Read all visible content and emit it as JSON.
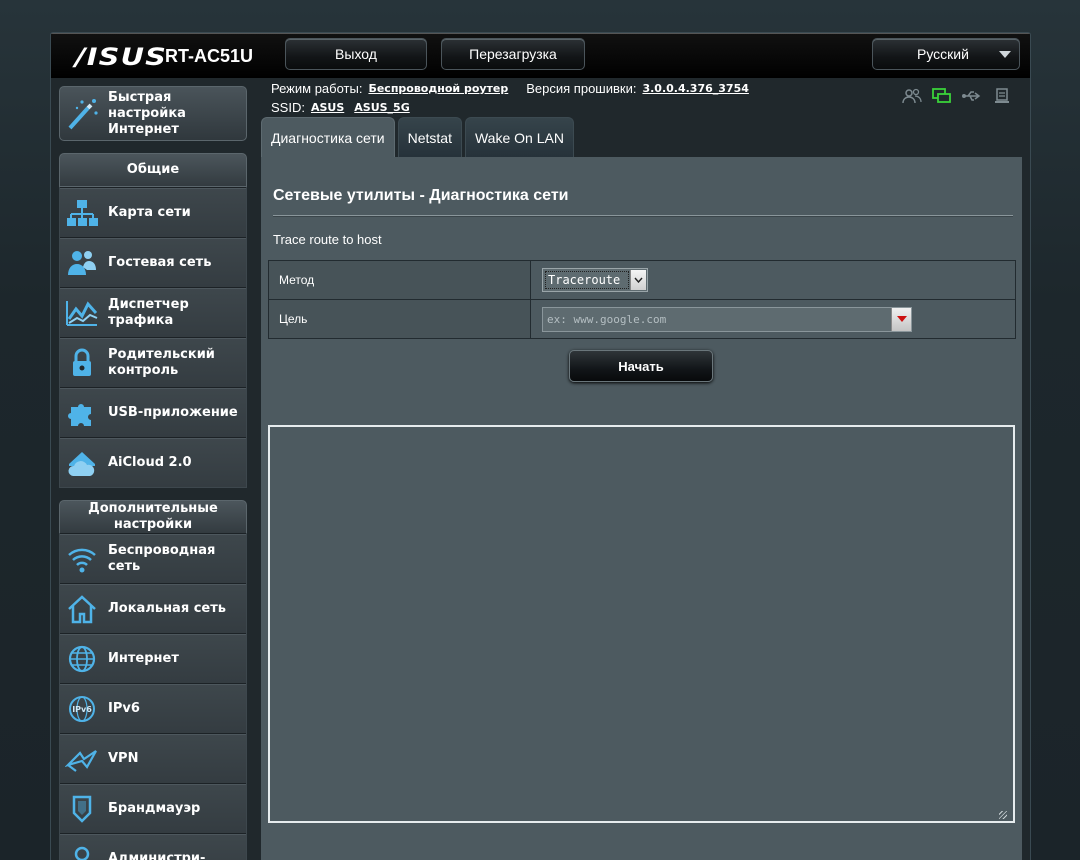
{
  "header": {
    "brand": "/ISUS",
    "model": "RT-AC51U",
    "logout_label": "Выход",
    "reboot_label": "Перезагрузка",
    "language_label": "Русский"
  },
  "status": {
    "mode_label": "Режим работы:",
    "mode_value": "Беспроводной роутер",
    "firmware_label": "Версия прошивки:",
    "firmware_value": "3.0.0.4.376_3754",
    "ssid_label": "SSID:",
    "ssid_1": "ASUS",
    "ssid_2": "ASUS_5G"
  },
  "sidebar": {
    "quick_setup": "Быстрая настройка Интернет",
    "general_header": "Общие",
    "general_items": [
      {
        "label": "Карта сети",
        "icon": "network-map-icon"
      },
      {
        "label": "Гостевая сеть",
        "icon": "guest-network-icon"
      },
      {
        "label": "Диспетчер трафика",
        "icon": "traffic-manager-icon"
      },
      {
        "label": "Родительский контроль",
        "icon": "parental-control-icon"
      },
      {
        "label": "USB-приложение",
        "icon": "usb-app-icon"
      },
      {
        "label": "AiCloud 2.0",
        "icon": "aicloud-icon"
      }
    ],
    "advanced_header": "Дополнительные настройки",
    "advanced_items": [
      {
        "label": "Беспроводная сеть",
        "icon": "wireless-icon"
      },
      {
        "label": "Локальная сеть",
        "icon": "lan-icon"
      },
      {
        "label": "Интернет",
        "icon": "wan-icon"
      },
      {
        "label": "IPv6",
        "icon": "ipv6-icon"
      },
      {
        "label": "VPN",
        "icon": "vpn-icon"
      },
      {
        "label": "Брандмауэр",
        "icon": "firewall-icon"
      },
      {
        "label": "Администри-",
        "icon": "administration-icon"
      }
    ]
  },
  "tabs": [
    {
      "label": "Диагностика сети",
      "active": true
    },
    {
      "label": "Netstat",
      "active": false
    },
    {
      "label": "Wake On LAN",
      "active": false
    }
  ],
  "main": {
    "title": "Сетевые утилиты - Диагностика сети",
    "description": "Trace route to host",
    "method_label": "Метод",
    "method_value": "Traceroute",
    "target_label": "Цель",
    "target_placeholder": "ex: www.google.com",
    "start_label": "Начать",
    "output": ""
  },
  "colors": {
    "content_bg": "#4d5a60",
    "frame_bg": "#20282c",
    "accent_icon": "#4fb3e8",
    "active_status_icon": "#3ad13a"
  }
}
